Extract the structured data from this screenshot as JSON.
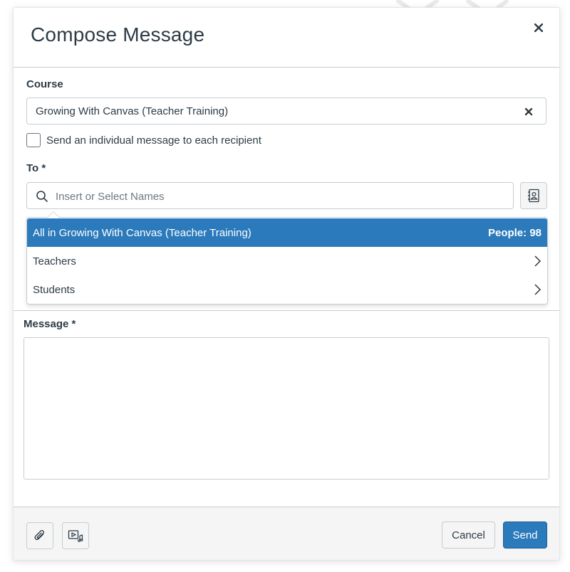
{
  "modal": {
    "title": "Compose Message"
  },
  "course": {
    "label": "Course",
    "value": "Growing With Canvas (Teacher Training)"
  },
  "individual_message": {
    "label": "Send an individual message to each recipient",
    "checked": false
  },
  "recipients": {
    "label": "To *",
    "placeholder": "Insert or Select Names",
    "options": [
      {
        "label": "All in Growing With Canvas (Teacher Training)",
        "count": "People: 98",
        "highlighted": true
      },
      {
        "label": "Teachers",
        "has_submenu": true
      },
      {
        "label": "Students",
        "has_submenu": true
      }
    ]
  },
  "message": {
    "label": "Message *",
    "value": ""
  },
  "footer": {
    "cancel_label": "Cancel",
    "send_label": "Send"
  },
  "icons": {
    "close": "close-icon",
    "clear": "clear-icon",
    "search": "search-icon",
    "address_book": "address-book-icon",
    "attachment": "paperclip-icon",
    "media": "media-icon",
    "chevron": "chevron-right-icon"
  },
  "colors": {
    "accent": "#2b7abc",
    "text": "#2d3b45",
    "border": "#c7cdd1",
    "footer_bg": "#f5f5f5"
  }
}
